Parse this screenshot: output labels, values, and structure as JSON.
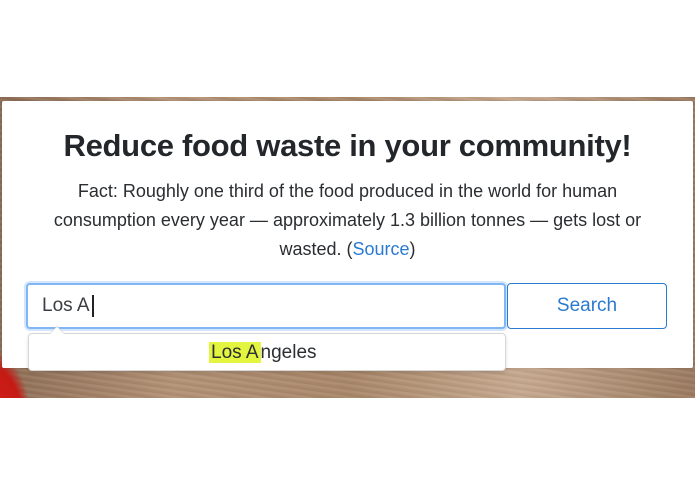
{
  "hero": {
    "title": "Reduce food waste in your community!",
    "fact": {
      "text": "Fact: Roughly one third of the food produced in the world for human consumption every year — approximately 1.3 billion tonnes — gets lost or wasted. (",
      "link_label": "Source",
      "suffix": ")"
    }
  },
  "search": {
    "value": "Los A",
    "button_label": "Search"
  },
  "autocomplete": {
    "items": [
      {
        "match": "Los A",
        "rest": "ngeles"
      }
    ]
  },
  "colors": {
    "accent": "#2a7ad1",
    "focus_ring": "#80b6f5",
    "highlight": "#e4f53f",
    "text": "#23262a"
  }
}
